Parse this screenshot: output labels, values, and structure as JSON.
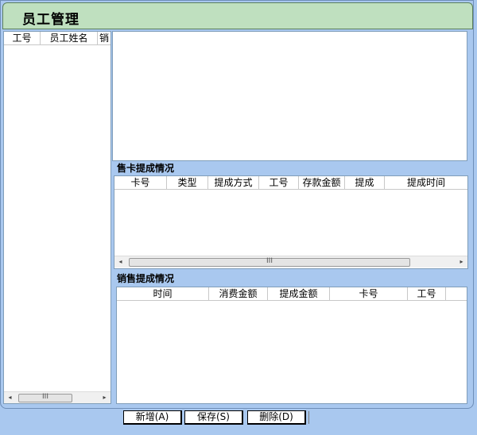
{
  "window": {
    "title": "员工管理"
  },
  "employee_list": {
    "columns": [
      "工号",
      "员工姓名",
      "销"
    ],
    "scroll_grip": "III"
  },
  "card_commission": {
    "label": "售卡提成情况",
    "columns": [
      "卡号",
      "类型",
      "提成方式",
      "工号",
      "存款金额",
      "提成",
      "提成时间"
    ],
    "scroll_grip": "III"
  },
  "sales_commission": {
    "label": "销售提成情况",
    "columns": [
      "时间",
      "消费金额",
      "提成金额",
      "卡号",
      "工号"
    ]
  },
  "actions": {
    "add": "新增(A)",
    "save": "保存(S)",
    "delete": "删除(D)"
  },
  "icons": {
    "left_arrow": "◂",
    "right_arrow": "▸"
  }
}
